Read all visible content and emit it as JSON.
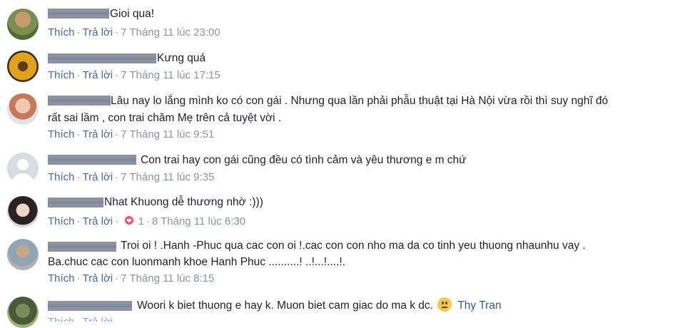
{
  "actions": {
    "like": "Thích",
    "reply": "Trả lời"
  },
  "comments": [
    {
      "text": "Gioi qua!",
      "time": "7 Tháng 11 lúc 23:00"
    },
    {
      "text": "Kưng quá",
      "time": "7 Tháng 11 lúc 17:15"
    },
    {
      "text_line1": "Lâu nay lo lắng mình ko có con gái . Nhưng qua lần phải phẫu thuật tại Hà Nội vừa rồi thì suy nghĩ đó",
      "text_line2": "rất sai lầm , con trai chăm Mẹ trên cả tuyệt vời .",
      "time": "7 Tháng 11 lúc 9:51"
    },
    {
      "text": "Con trai hay con gái cũng đều có tình cảm và yêu thương e m chứ",
      "time": "7 Tháng 11 lúc 9:35"
    },
    {
      "text": "Nhat Khuong dễ thương nhờ :)))",
      "reaction_count": "1",
      "time": "8 Tháng 11 lúc 6:30"
    },
    {
      "text_line1": "Troi oi ! .Hanh -Phuc qua cac con oi !.cac con con nho ma da co tinh yeu thuong nhaunhu vay .",
      "text_line2": "Ba.chuc cac con luonmanh khoe Hanh Phuc ..........! ..!...!....!.",
      "time": "7 Tháng 11 lúc 8:15"
    },
    {
      "text": "Woori k biet thuong e hay k. Muon biet cam giac do ma k dc.",
      "tag": "Thy Tran"
    }
  ],
  "colors": {
    "link": "#4b67a1",
    "meta": "#8d949e",
    "text": "#1d2129",
    "tag": "#365899"
  }
}
